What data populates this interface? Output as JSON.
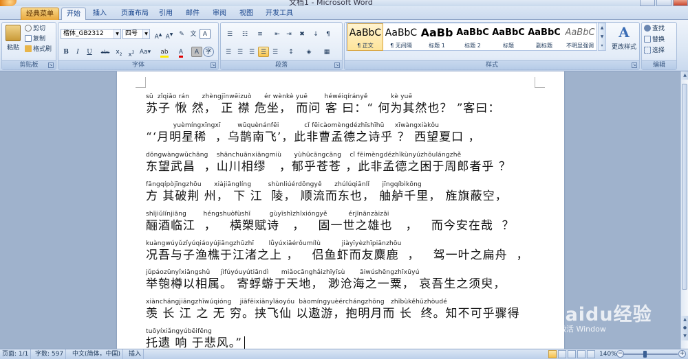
{
  "window": {
    "title": "文档1 - Microsoft Word"
  },
  "tabs": [
    "经典菜单",
    "开始",
    "插入",
    "页面布局",
    "引用",
    "邮件",
    "审阅",
    "视图",
    "开发工具"
  ],
  "active_tab": "开始",
  "ribbon": {
    "clipboard": {
      "label": "剪贴板",
      "paste": "粘贴",
      "cut": "剪切",
      "copy": "复制",
      "format_painter": "格式刷"
    },
    "font": {
      "label": "字体",
      "font_name": "楷体_GB2312",
      "font_size": "四号"
    },
    "paragraph": {
      "label": "段落"
    },
    "styles": {
      "label": "样式",
      "items": [
        {
          "sample": "AaBbC",
          "name": "¶ 正文"
        },
        {
          "sample": "AaBbC",
          "name": "¶ 无间隔"
        },
        {
          "sample": "AaBb",
          "name": "标题 1"
        },
        {
          "sample": "AaBbC",
          "name": "标题 2"
        },
        {
          "sample": "AaBbC",
          "name": "标题"
        },
        {
          "sample": "AaBbC",
          "name": "副标题"
        },
        {
          "sample": "AaBbC",
          "name": "不明显强调"
        }
      ],
      "change_styles": "更改样式"
    },
    "editing": {
      "label": "编辑",
      "find": "查找",
      "replace": "替换",
      "select": "选择"
    }
  },
  "document": {
    "lines": [
      {
        "pinyin": "sū  zǐqiǎo rán      zhèngjīnwēizuò      ér wènkè yuē        héwéiqírányě           kè yuē",
        "text": "苏子 愀 然， 正 襟 危坐， 而问 客 曰：“ 何为其然也？ ”客曰："
      },
      {
        "pinyin": "             yuèmíngxīngxī        wūquènánfēi            cǐ fēicàomèngdézhīshīhū     xīwàngxiàkǒu",
        "text": "“‘月明星稀  ，乌鹊南飞’，此非曹孟德之诗乎 ？ 西望夏口 ，"
      },
      {
        "pinyin": "dōngwàngwǔchāng    shānchuānxiāngmiù      yùhūcāngcāng    cǐ fēimèngdézhīkùnyúzhōulángzhě",
        "text": "东望武昌  ，山川相缪   ，郁乎苍苍 ，此非孟德之困于周郎者乎 ？"
      },
      {
        "pinyin": "fāngqípòjīngzhōu      xiàjiānglíng        shùnliúérdōngyě      zhúlúqiānlǐ      jīngqíbìkōng",
        "text": "方 其破荆 州， 下 江  陵， 顺流而东也， 舳舻千里， 旌旗蔽空，"
      },
      {
        "pinyin": "shījiǔlínjiāng        héngshuòfùshī         gùyīshìzhīxióngyě          érjīnānzàizāi",
        "text": "酾酒临江  ，   横槊赋诗   ，   固一世之雄也   ，   而今安在哉  ？"
      },
      {
        "pinyin": "kuàngwúyǔzǐyúqiáoyújiāngzhūzhī       lǚyúxiāérǒumílù          jiàyīyèzhīpiānzhōu",
        "text": "况吾与子渔樵于江渚之上 ，   侣鱼虾而友麋鹿  ，   驾一叶之扁舟  ，"
      },
      {
        "pinyin": "jǔpáozūnyǐxiāngshǔ     jìfúyóuyútiāndì      miǎocānghǎizhīyīsù       āiwúshēngzhīxūyú",
        "text": "举匏樽以相属。 寄蜉蝣于天地， 渺沧海之一粟， 哀吾生之须臾，"
      },
      {
        "pinyin": "xiànchángjiāngzhīwúqióng    jiāfēixiānyǐáoyóu  bàomíngyuèérchángzhōng   zhībùkěhūzhòudé",
        "text": "羡 长 江 之 无 穷。挟飞仙 以遨游，抱明月而 长  终。知不可乎骤得"
      },
      {
        "pinyin": "tuōyíxiǎngyúbēifēng",
        "text": "托遗 响 于悲风。”"
      }
    ]
  },
  "watermark": {
    "brand": "Baidu经验",
    "sub": "激活 Window"
  },
  "status": {
    "page": "页面: 1/1",
    "words": "字数: 597",
    "language": "中文(简体，中国)",
    "mode": "插入",
    "zoom": "140%"
  }
}
